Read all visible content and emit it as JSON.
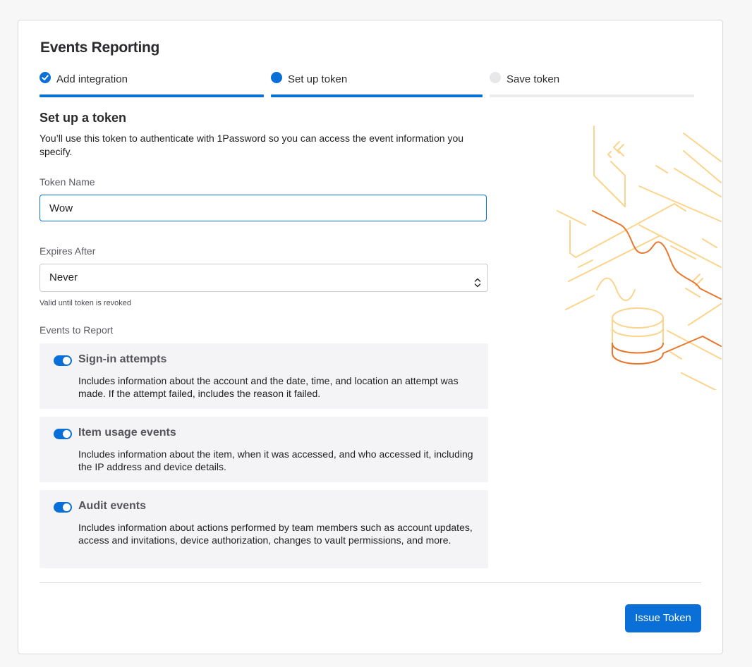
{
  "title": "Events Reporting",
  "steps": [
    {
      "label": "Add integration",
      "state": "complete"
    },
    {
      "label": "Set up token",
      "state": "active"
    },
    {
      "label": "Save token",
      "state": "upcoming"
    }
  ],
  "section": {
    "heading": "Set up a token",
    "description": "You’ll use this token to authenticate with 1Password so you can access the event information you specify."
  },
  "token_name": {
    "label": "Token Name",
    "value": "Wow"
  },
  "expires": {
    "label": "Expires After",
    "value": "Never",
    "hint": "Valid until token is revoked"
  },
  "events": {
    "label": "Events to Report",
    "items": [
      {
        "title": "Sign-in attempts",
        "description": "Includes information about the account and the date, time, and location an attempt was made. If the attempt failed, includes the reason it failed.",
        "enabled": true
      },
      {
        "title": "Item usage events",
        "description": "Includes information about the item, when it was accessed, and who accessed it, including the IP address and device details.",
        "enabled": true
      },
      {
        "title": "Audit events",
        "description": "Includes information about actions performed by team members such as account updates, access and invitations, device authorization, changes to vault permissions, and more.",
        "enabled": true
      }
    ]
  },
  "actions": {
    "issue_label": "Issue Token"
  },
  "colors": {
    "accent": "#0a6fd6",
    "illustration_light": "#fcd48c",
    "illustration_dark": "#e8772e"
  }
}
